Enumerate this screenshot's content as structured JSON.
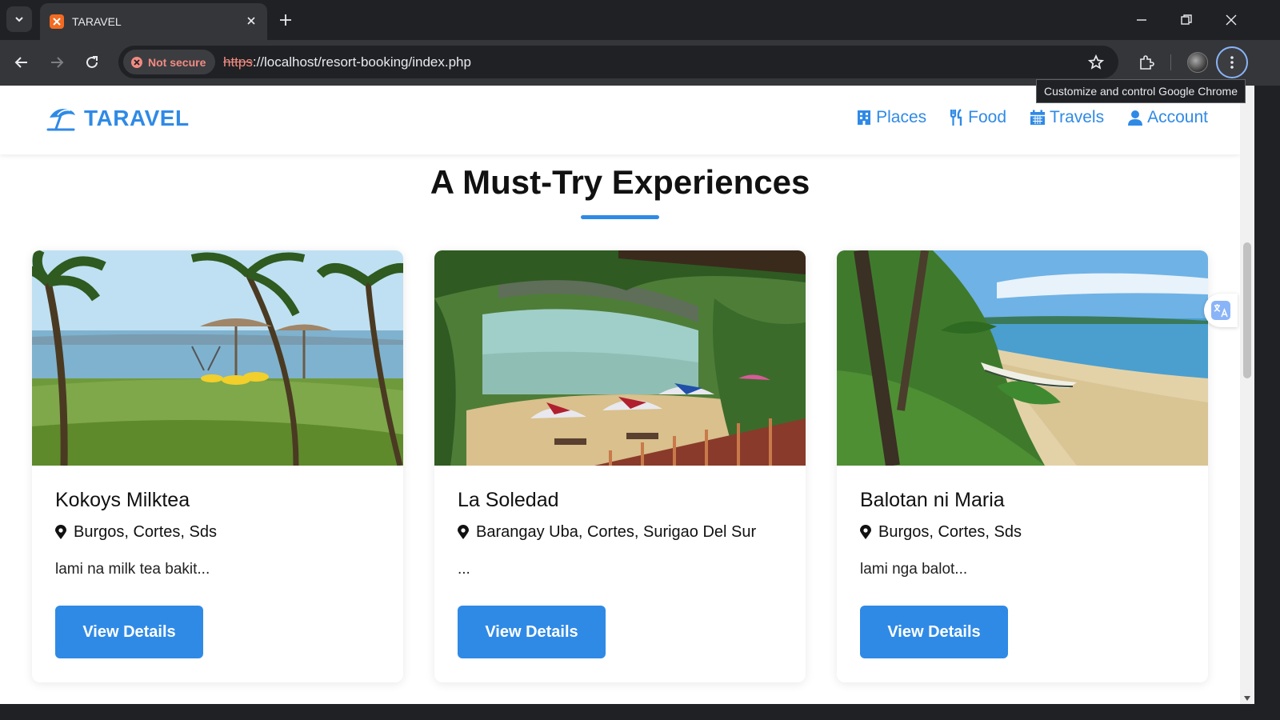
{
  "browser": {
    "tab_title": "TARAVEL",
    "security_label": "Not secure",
    "url_protocol": "https",
    "url_rest": "://localhost/resort-booking/index.php",
    "tooltip": "Customize and control Google Chrome"
  },
  "site": {
    "brand": "TARAVEL",
    "nav": [
      {
        "label": "Places",
        "icon": "building-icon"
      },
      {
        "label": "Food",
        "icon": "utensils-icon"
      },
      {
        "label": "Travels",
        "icon": "calendar-icon"
      },
      {
        "label": "Account",
        "icon": "user-icon"
      }
    ],
    "section_title": "A Must-Try Experiences",
    "cards": [
      {
        "name": "Kokoys Milktea",
        "location": "Burgos, Cortes, Sds",
        "description": "lami na milk tea bakit...",
        "button": "View Details",
        "image": "beach-palm-umbrellas-photo"
      },
      {
        "name": "La Soledad",
        "location": "Barangay Uba, Cortes, Surigao Del Sur",
        "description": "...",
        "button": "View Details",
        "image": "beach-cove-umbrellas-photo"
      },
      {
        "name": "Balotan ni Maria",
        "location": "Burgos, Cortes, Sds",
        "description": "lami nga balot...",
        "button": "View Details",
        "image": "beach-shore-boat-photo"
      }
    ]
  },
  "colors": {
    "accent": "#2f8ae6",
    "chrome_dark": "#202124",
    "chrome_toolbar": "#35363a",
    "warning_red": "#f28b82"
  }
}
